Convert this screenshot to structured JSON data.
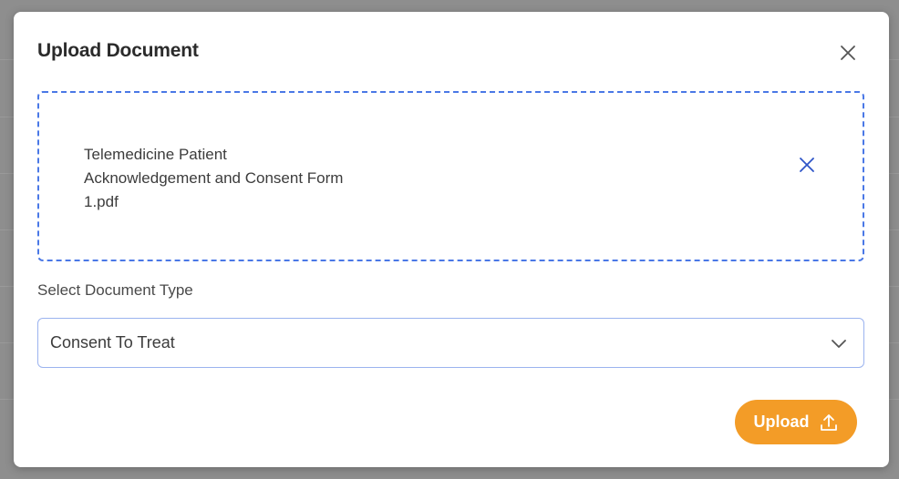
{
  "modal": {
    "title": "Upload Document"
  },
  "dropzone": {
    "file_name_lines": [
      "Telemedicine Patient",
      "Acknowledgement and Consent Form",
      "1.pdf"
    ]
  },
  "document_type": {
    "label": "Select Document Type",
    "selected": "Consent To Treat"
  },
  "actions": {
    "upload_label": "Upload"
  },
  "icons": {
    "close": "close-icon",
    "remove_file": "close-icon",
    "dropdown": "chevron-down-icon",
    "upload": "upload-icon"
  },
  "colors": {
    "accent": "#f39c27",
    "dropzone_border": "#4a78e6",
    "remove_icon": "#2f55c8",
    "overlay": "#8e8e8e"
  }
}
